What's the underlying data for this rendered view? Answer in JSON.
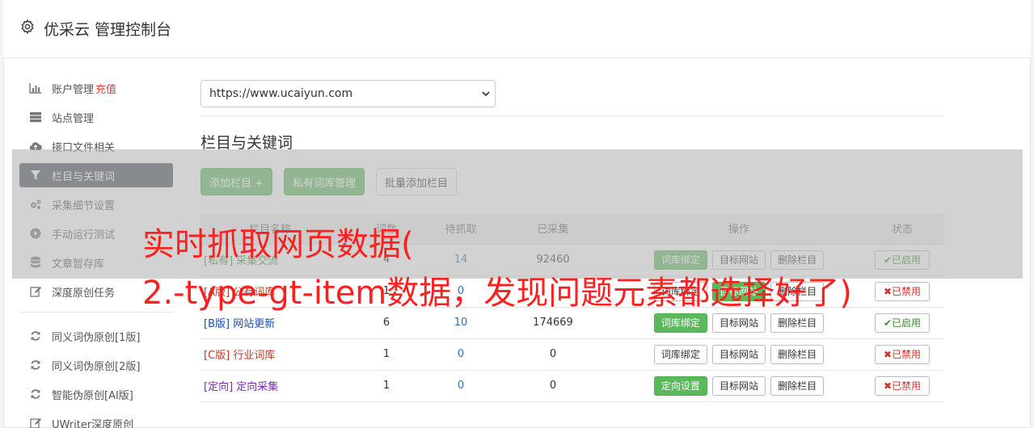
{
  "header": {
    "title": "优采云 管理控制台"
  },
  "sidebar": {
    "items": [
      {
        "label": "账户管理",
        "extra": "充值",
        "icon": "bar-chart-icon"
      },
      {
        "label": "站点管理",
        "icon": "server-icon"
      },
      {
        "label": "接口文件相关",
        "icon": "cloud-upload-icon"
      },
      {
        "label": "栏目与关键词",
        "icon": "filter-icon",
        "active": true
      },
      {
        "label": "采集细节设置",
        "icon": "cogs-icon"
      },
      {
        "label": "手动运行测试",
        "icon": "play-circle-icon"
      },
      {
        "label": "文章暂存库",
        "icon": "database-icon"
      },
      {
        "label": "深度原创任务",
        "icon": "edit-icon"
      }
    ],
    "items2": [
      {
        "label": "同义词伪原创[1版]",
        "icon": "refresh-icon"
      },
      {
        "label": "同义词伪原创[2版]",
        "icon": "refresh-icon"
      },
      {
        "label": "智能伪原创[AI版]",
        "icon": "refresh-icon"
      },
      {
        "label": "UWriter深度原创",
        "icon": "edit-icon"
      }
    ]
  },
  "main": {
    "site_select": "https://www.ucaiyun.com",
    "section_title": "栏目与关键词",
    "buttons": {
      "add": "添加栏目 +",
      "private": "私有词库管理",
      "batch": "批量添加栏目"
    },
    "table": {
      "headers": [
        "栏目名称",
        "词数",
        "待抓取",
        "已采集",
        "操作",
        "状态"
      ],
      "rows": [
        {
          "tag": "[私有]",
          "name": "采集交流",
          "words": "4",
          "pending": "14",
          "collected": "92460",
          "op1": "词库绑定",
          "op1_green": true,
          "op2": "目标网站",
          "op3": "删除栏目",
          "status": "✔已启用",
          "on": true,
          "color": "green"
        },
        {
          "tag": "[A版]",
          "name": "公有词库",
          "words": "1",
          "pending": "0",
          "collected": "",
          "op1": "词库绑定",
          "op1_green": false,
          "op2": "目标网站",
          "op3": "删除栏目",
          "status": "✖已禁用",
          "on": false,
          "color": "red"
        },
        {
          "tag": "[B版]",
          "name": "网站更新",
          "words": "6",
          "pending": "10",
          "collected": "174669",
          "op1": "词库绑定",
          "op1_green": true,
          "op2": "目标网站",
          "op3": "删除栏目",
          "status": "✔已启用",
          "on": true,
          "color": "blue"
        },
        {
          "tag": "[C版]",
          "name": "行业词库",
          "words": "1",
          "pending": "0",
          "collected": "0",
          "op1": "词库绑定",
          "op1_green": false,
          "op2": "目标网站",
          "op3": "删除栏目",
          "status": "✖已禁用",
          "on": false,
          "color": "red"
        },
        {
          "tag": "[定向]",
          "name": "定向采集",
          "words": "1",
          "pending": "0",
          "collected": "0",
          "op1": "定向设置",
          "op1_green": true,
          "op2": "目标网站",
          "op3": "删除栏目",
          "status": "✖已禁用",
          "on": false,
          "color": "purple"
        }
      ]
    }
  },
  "watermark": {
    "line1": "实时抓取网页数据(",
    "line2": "2.-type-gt-item数据，发现问题元素都选择好了)"
  }
}
